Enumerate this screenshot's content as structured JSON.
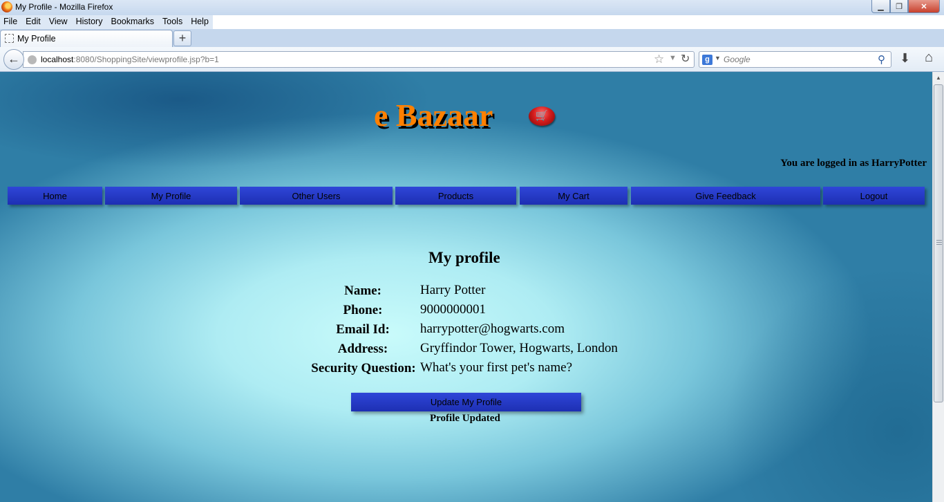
{
  "window": {
    "title": "My Profile - Mozilla Firefox",
    "minimize_glyph": "▁",
    "maximize_glyph": "❐",
    "close_glyph": "✕"
  },
  "menu": [
    "File",
    "Edit",
    "View",
    "History",
    "Bookmarks",
    "Tools",
    "Help"
  ],
  "tab": {
    "label": "My Profile",
    "new_tab_glyph": "+"
  },
  "navbar": {
    "url_host": "localhost",
    "url_rest": ":8080/ShoppingSite/viewprofile.jsp?b=1",
    "search_placeholder": "Google",
    "search_engine_glyph": "g"
  },
  "page": {
    "logo": "e Bazaar",
    "logged_in_text": "You are logged in as HarryPotter",
    "nav_items": [
      "Home",
      "My Profile",
      "Other Users",
      "Products",
      "My Cart",
      "Give Feedback",
      "Logout"
    ],
    "heading": "My profile",
    "fields": [
      {
        "label": "Name:",
        "value": "Harry Potter"
      },
      {
        "label": "Phone:",
        "value": "9000000001"
      },
      {
        "label": "Email Id:",
        "value": "harrypotter@hogwarts.com"
      },
      {
        "label": "Address:",
        "value": "Gryffindor Tower, Hogwarts, London"
      },
      {
        "label": "Security Question:",
        "value": "What's your first pet's name?"
      }
    ],
    "update_button": "Update My Profile",
    "status": "Profile Updated"
  },
  "colors": {
    "logo_orange": "#ff8000",
    "nav_button_blue": "#2338c8",
    "close_red": "#c8412d"
  },
  "icons": {
    "cart": "shopping-cart-icon",
    "back": "back-arrow-icon",
    "bookmark": "star-icon",
    "reload": "reload-icon",
    "search": "magnifier-icon",
    "downloads": "download-arrow-icon",
    "home": "home-icon"
  }
}
